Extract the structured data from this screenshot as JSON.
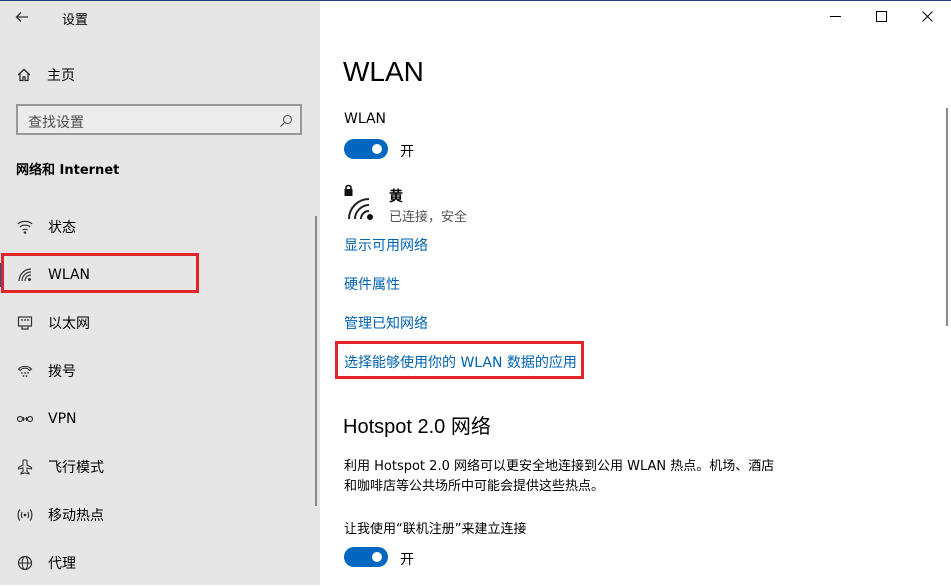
{
  "window": {
    "title": "设置",
    "controls": [
      "minimize",
      "maximize",
      "close"
    ]
  },
  "sidebar": {
    "home_label": "主页",
    "search_placeholder": "查找设置",
    "section_title": "网络和 Internet",
    "items": [
      {
        "label": "状态",
        "icon": "status-icon"
      },
      {
        "label": "WLAN",
        "icon": "wifi-icon",
        "selected": true
      },
      {
        "label": "以太网",
        "icon": "ethernet-icon"
      },
      {
        "label": "拨号",
        "icon": "dialup-icon"
      },
      {
        "label": "VPN",
        "icon": "vpn-icon"
      },
      {
        "label": "飞行模式",
        "icon": "airplane-icon"
      },
      {
        "label": "移动热点",
        "icon": "hotspot-icon"
      },
      {
        "label": "代理",
        "icon": "globe-icon"
      }
    ]
  },
  "main": {
    "title": "WLAN",
    "wlan_label": "WLAN",
    "wlan_toggle_state": "开",
    "wlan_toggle_on": true,
    "network": {
      "name": "黄",
      "status": "已连接，安全"
    },
    "links": {
      "show_networks": "显示可用网络",
      "hardware_props": "硬件属性",
      "manage_known": "管理已知网络",
      "choose_apps": "选择能够使用你的 WLAN 数据的应用"
    },
    "hotspot": {
      "heading": "Hotspot 2.0 网络",
      "description": "利用 Hotspot 2.0 网络可以更安全地连接到公用 WLAN 热点。机场、酒店和咖啡店等公共场所中可能会提供这些热点。",
      "option_label": "让我使用“联机注册”来建立连接",
      "toggle_state": "开",
      "toggle_on": true
    }
  },
  "colors": {
    "accent": "#0067c0",
    "link": "#0063b1",
    "highlight_box": "#e0262b",
    "sidebar_bg": "#e6e6e6"
  }
}
